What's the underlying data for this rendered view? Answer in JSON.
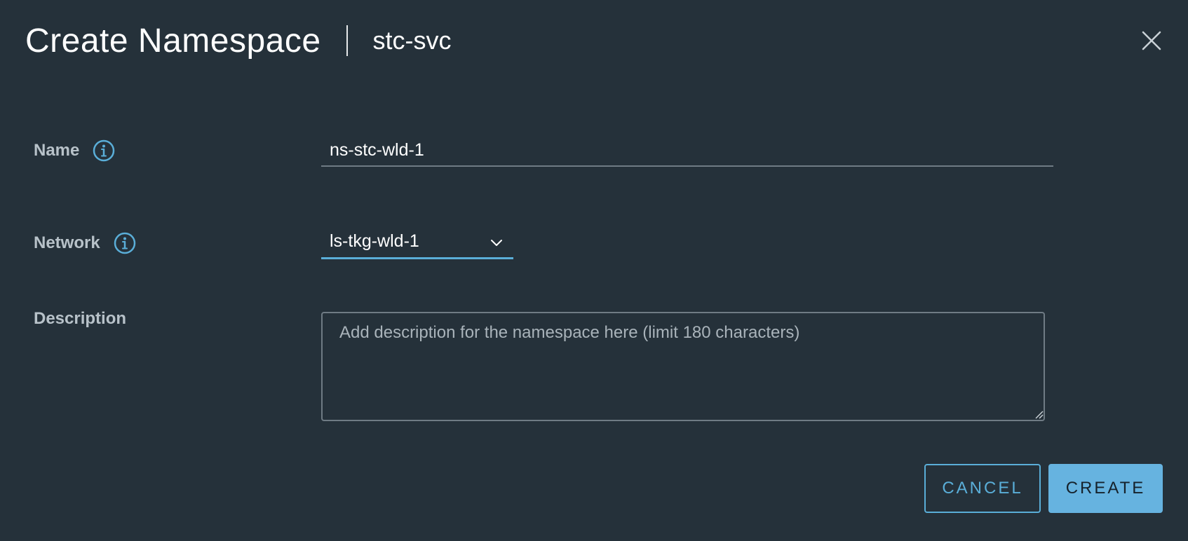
{
  "dialog": {
    "title": "Create Namespace",
    "subtitle": "stc-svc",
    "close_icon": "close-icon"
  },
  "form": {
    "name": {
      "label": "Name",
      "value": "ns-stc-wld-1",
      "info_icon": "info-icon"
    },
    "network": {
      "label": "Network",
      "selected": "ls-tkg-wld-1",
      "info_icon": "info-icon",
      "chevron_icon": "chevron-down-icon"
    },
    "description": {
      "label": "Description",
      "placeholder": "Add description for the namespace here (limit 180 characters)",
      "value": ""
    }
  },
  "actions": {
    "cancel_label": "CANCEL",
    "create_label": "CREATE"
  },
  "colors": {
    "background": "#25313a",
    "accent": "#5aaed8",
    "primary_button": "#66b3e0",
    "label_text": "#b8c2c9"
  }
}
